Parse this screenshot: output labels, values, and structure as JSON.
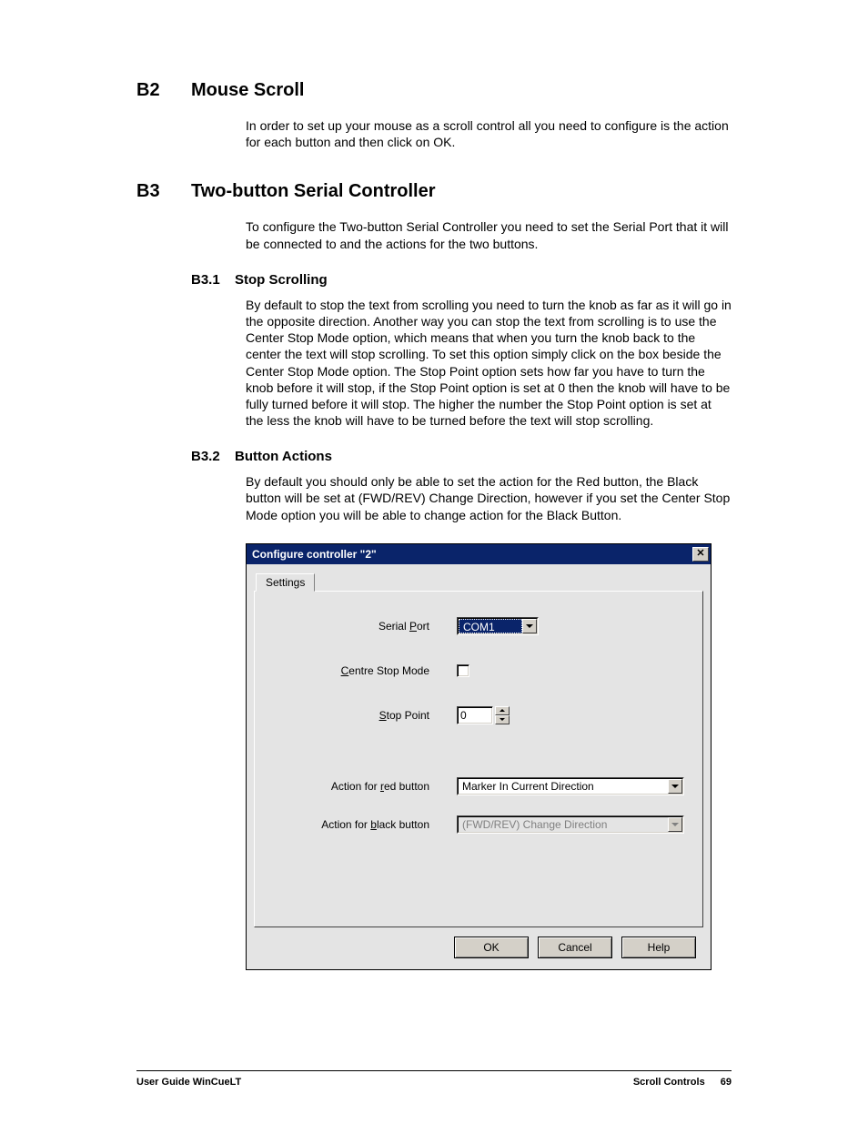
{
  "sections": {
    "b2": {
      "num": "B2",
      "title": "Mouse Scroll",
      "body": "In order to set up your mouse as a scroll control all you need to configure is the action for each button and then click on OK."
    },
    "b3": {
      "num": "B3",
      "title": "Two-button Serial Controller",
      "body": "To configure the Two-button Serial Controller you need to set the Serial Port that it will be connected to and the actions for the two buttons."
    },
    "b31": {
      "num": "B3.1",
      "title": "Stop Scrolling",
      "body": "By default to stop the text from scrolling you need to turn the knob as far as it will go in the opposite direction. Another way you can stop the text from scrolling is to use the Center Stop Mode option, which means that when you turn the knob back to the center the text will stop scrolling. To set this option simply click on the box beside the Center Stop Mode option. The Stop Point option sets how far you have to turn the knob before it will stop, if the Stop Point option is set at 0 then the knob will have to be fully turned before it will stop. The higher the number the Stop Point option is set at the less the knob will have to be turned before the text will stop scrolling."
    },
    "b32": {
      "num": "B3.2",
      "title": "Button Actions",
      "body": "By default you should only be able to set the action for the Red button, the Black button will be set at (FWD/REV) Change Direction, however if you set the Center Stop Mode option you will be able to change action for the Black Button."
    }
  },
  "dialog": {
    "title": "Configure controller \"2\"",
    "tab": "Settings",
    "labels": {
      "serial_port_pre": "Serial ",
      "serial_port_u": "P",
      "serial_port_post": "ort",
      "centre_u": "C",
      "centre_post": "entre Stop Mode",
      "stop_u": "S",
      "stop_post": "top Point",
      "red_pre": "Action for ",
      "red_u": "r",
      "red_post": "ed button",
      "black_pre": "Action for ",
      "black_u": "b",
      "black_post": "lack button"
    },
    "values": {
      "serial_port": "COM1",
      "stop_point": "0",
      "red_action": "Marker In Current Direction",
      "black_action": "(FWD/REV) Change Direction"
    },
    "buttons": {
      "ok": "OK",
      "cancel": "Cancel",
      "help": "Help"
    }
  },
  "footer": {
    "left": "User Guide WinCueLT",
    "right_section": "Scroll Controls",
    "page": "69"
  }
}
